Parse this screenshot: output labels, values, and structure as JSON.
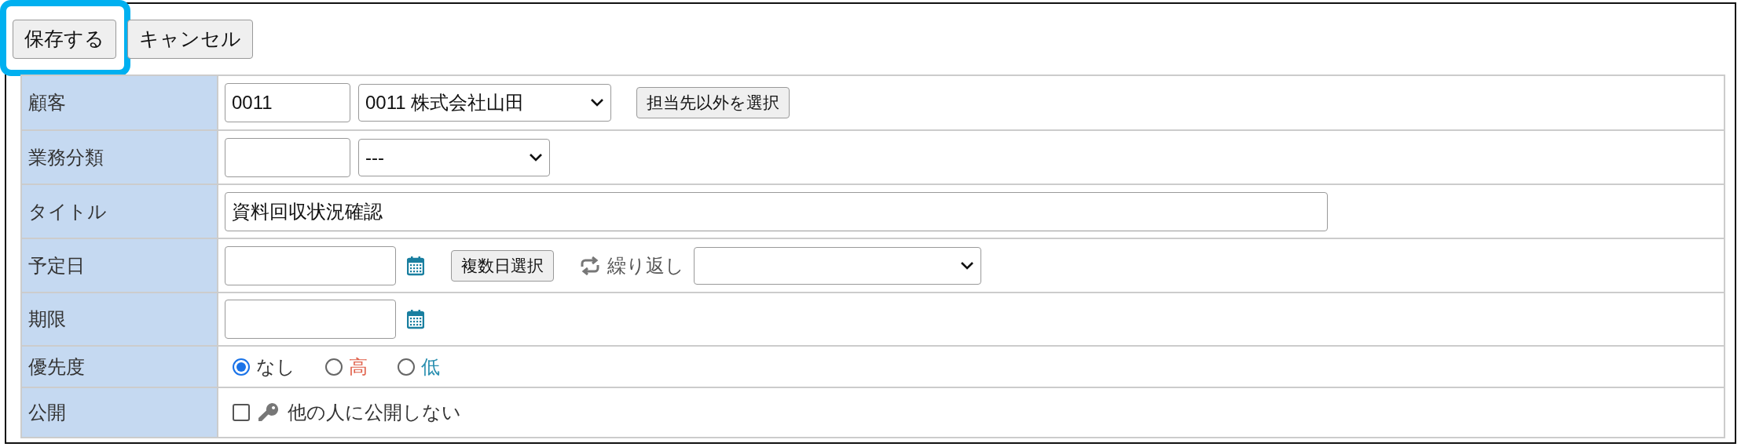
{
  "buttons": [
    {
      "label": "保存する",
      "highlighted": true
    },
    {
      "label": "キャンセル",
      "highlighted": false
    }
  ],
  "form": {
    "rows": [
      {
        "label": "顧客",
        "kind": "customer",
        "code": "0011",
        "select": "0011 株式会社山田",
        "button": "担当先以外を選択"
      },
      {
        "label": "業務分類",
        "kind": "category",
        "select": "---"
      },
      {
        "label": "タイトル",
        "kind": "text",
        "value": "資料回収状況確認"
      },
      {
        "label": "予定日",
        "kind": "date_repeat",
        "button": "複数日選択",
        "repeat_label": "繰り返し"
      },
      {
        "label": "期限",
        "kind": "date"
      },
      {
        "label": "優先度",
        "kind": "radio",
        "options": [
          {
            "label": "なし",
            "selected": true,
            "color": "#333333"
          },
          {
            "label": "高",
            "selected": false,
            "color": "#e0604a"
          },
          {
            "label": "低",
            "selected": false,
            "color": "#2a8fb0"
          }
        ]
      },
      {
        "label": "公開",
        "kind": "checkbox",
        "text": "他の人に公開しない",
        "checked": false
      }
    ]
  }
}
